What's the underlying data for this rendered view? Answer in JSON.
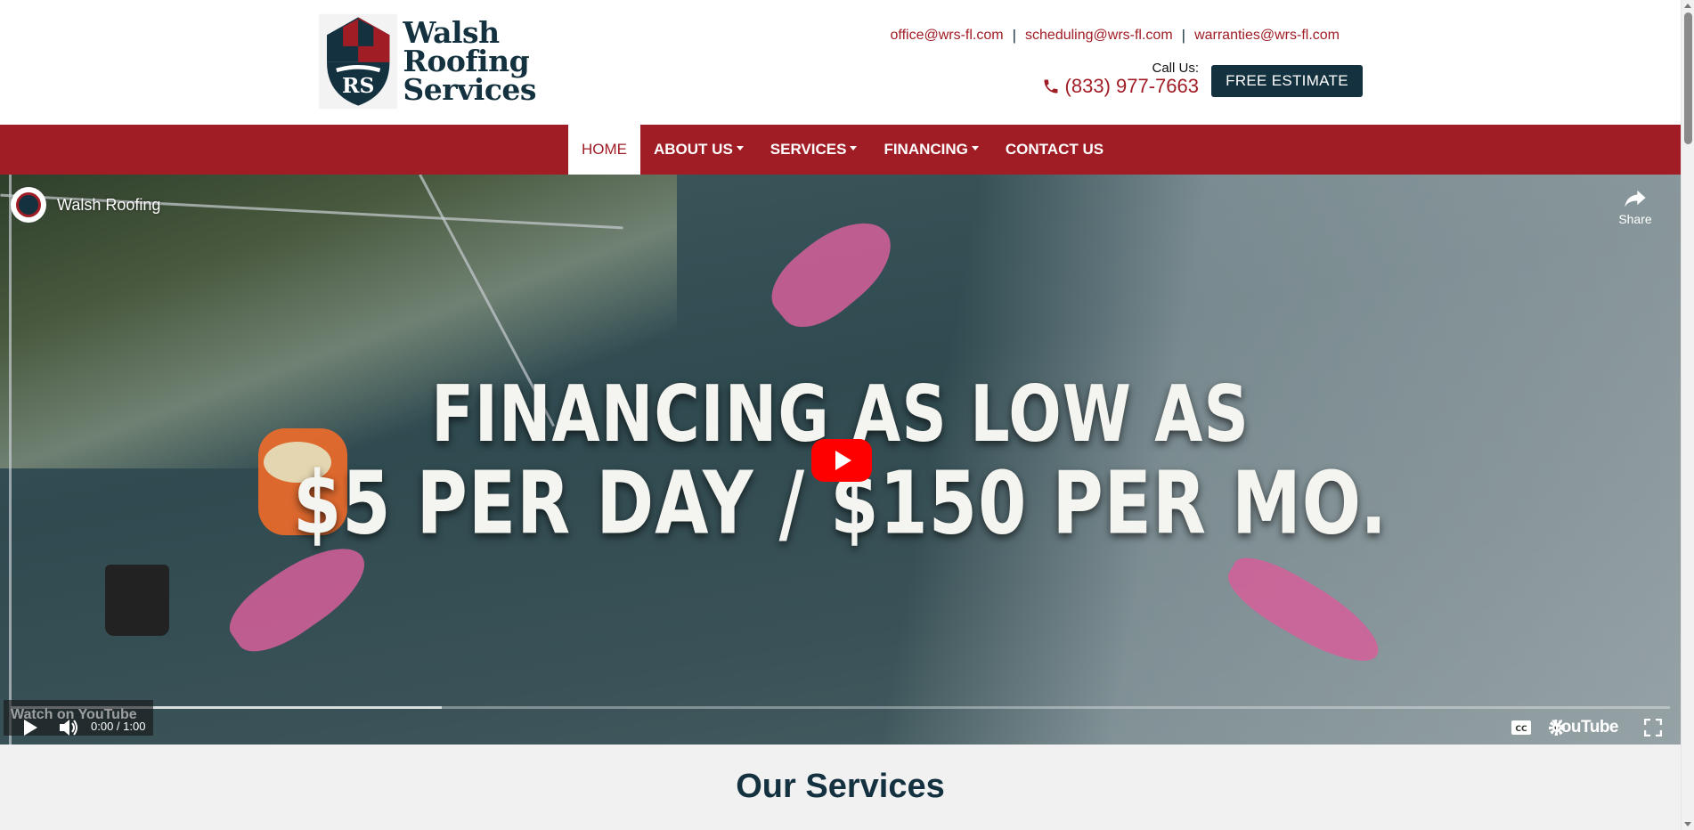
{
  "brand": {
    "name_line1": "Walsh",
    "name_line2": "Roofing",
    "name_line3": "Services",
    "primary_color": "#a11d25",
    "dark_color": "#14313f"
  },
  "header": {
    "emails": [
      "office@wrs-fl.com",
      "scheduling@wrs-fl.com",
      "warranties@wrs-fl.com"
    ],
    "separator": "|",
    "call_label": "Call Us:",
    "phone": "(833) 977-7663",
    "phone_icon": "phone-icon",
    "estimate_button": "FREE ESTIMATE"
  },
  "nav": {
    "items": [
      {
        "label": "HOME",
        "active": true,
        "dropdown": false
      },
      {
        "label": "ABOUT US",
        "active": false,
        "dropdown": true
      },
      {
        "label": "SERVICES",
        "active": false,
        "dropdown": true
      },
      {
        "label": "FINANCING",
        "active": false,
        "dropdown": true
      },
      {
        "label": "CONTACT US",
        "active": false,
        "dropdown": false
      }
    ]
  },
  "video": {
    "channel_title": "Walsh Roofing",
    "share_label": "Share",
    "promo_line1": "FINANCING AS LOW AS",
    "promo_line2": "$5 PER DAY / $150 PER MO.",
    "watch_on": "Watch on",
    "watch_on_brand": "YouTube",
    "time": "0:00 / 1:00",
    "youtube_label": "YouTube",
    "progress_fraction": 0.26
  },
  "section": {
    "title": "Our Services"
  }
}
